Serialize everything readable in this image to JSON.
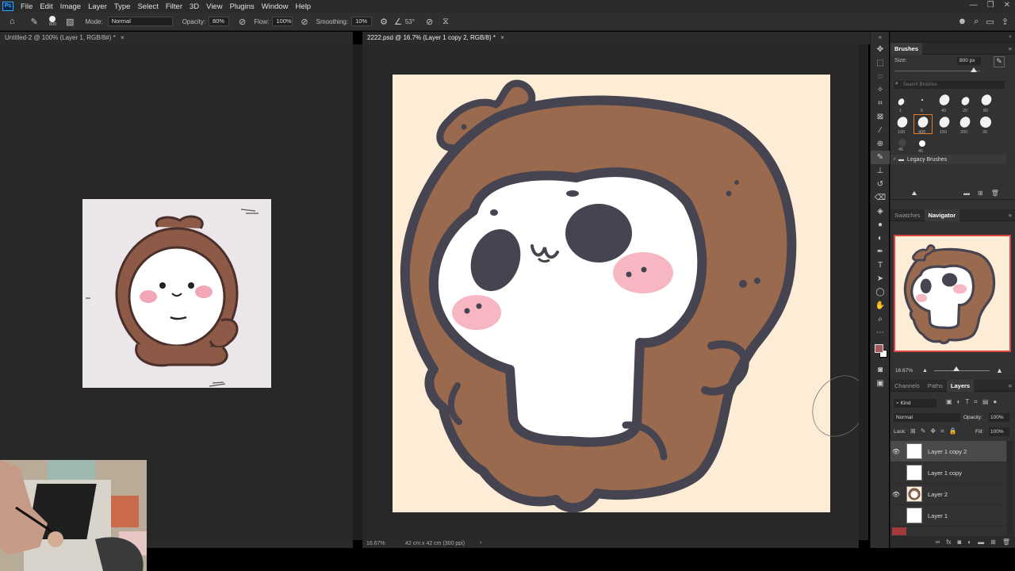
{
  "menubar": {
    "logo": "Ps",
    "items": [
      "File",
      "Edit",
      "Image",
      "Layer",
      "Type",
      "Select",
      "Filter",
      "3D",
      "View",
      "Plugins",
      "Window",
      "Help"
    ]
  },
  "options": {
    "brush_size": "800",
    "mode_label": "Mode:",
    "mode_value": "Normal",
    "opacity_label": "Opacity:",
    "opacity_value": "80%",
    "flow_label": "Flow:",
    "flow_value": "100%",
    "smoothing_label": "Smoothing:",
    "smoothing_value": "10%",
    "angle_value": "53°"
  },
  "tabs": {
    "left": "Untitled-2 @ 100% (Layer 1, RGB/8#) *",
    "right": "2222.psd @ 16.7% (Layer 1 copy 2, RGB/8) *"
  },
  "status": {
    "zoom": "16.67%",
    "doc_size": "42 cm x 42 cm (300 ppi)"
  },
  "brushes_panel": {
    "title": "Brushes",
    "size_label": "Size:",
    "size_value": "800 px",
    "search_placeholder": "Search Brushes",
    "presets": [
      "1",
      "5",
      "40",
      "20",
      "80",
      "100",
      "400",
      "150",
      "200",
      "30",
      "45",
      "45"
    ],
    "folder": "Legacy Brushes"
  },
  "navigator_panel": {
    "tabs": [
      "Swatches",
      "Navigator"
    ],
    "active_tab": "Navigator",
    "zoom": "16.67%"
  },
  "layers_panel": {
    "tabs": [
      "Channels",
      "Paths",
      "Layers"
    ],
    "active_tab": "Layers",
    "filter": "Kind",
    "blend_mode": "Normal",
    "opacity_label": "Opacity:",
    "opacity_value": "100%",
    "lock_label": "Lock:",
    "fill_label": "Fill:",
    "fill_value": "100%",
    "layers": [
      {
        "name": "Layer 1 copy 2",
        "visible": true,
        "active": true
      },
      {
        "name": "Layer 1 copy",
        "visible": false,
        "active": false
      },
      {
        "name": "Layer 2",
        "visible": true,
        "active": false
      },
      {
        "name": "Layer 1",
        "visible": false,
        "active": false
      }
    ]
  },
  "colors": {
    "canvas_bg": "#fdecd6",
    "monkey_brown": "#9a6a4f",
    "outline": "#454450",
    "blush": "#f6b7c2",
    "foreground": "#a45a5a",
    "background_swatch": "#ffffff"
  }
}
